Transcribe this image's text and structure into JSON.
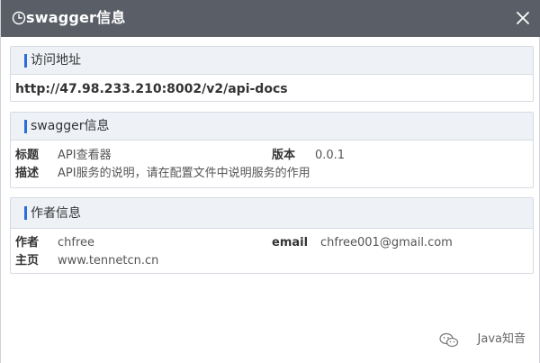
{
  "titlebar": {
    "title": "swagger信息",
    "clock_icon": "clock-icon",
    "close_icon": "close-icon"
  },
  "access_section": {
    "header": "访问地址",
    "url": "http://47.98.233.210:8002/v2/api-docs"
  },
  "swagger_section": {
    "header": "swagger信息",
    "title_key": "标题",
    "title_value": "API查看器",
    "version_key": "版本",
    "version_value": "0.0.1",
    "desc_key": "描述",
    "desc_value": "API服务的说明，请在配置文件中说明服务的作用"
  },
  "author_section": {
    "header": "作者信息",
    "author_key": "作者",
    "author_value": "chfree",
    "email_key": "email",
    "email_value": "chfree001@gmail.com",
    "homepage_key": "主页",
    "homepage_value": "www.tennetcn.cn"
  },
  "watermark": {
    "text": "Java知音",
    "icon": "wechat-icon"
  },
  "colors": {
    "titlebar": "#5a5e66",
    "accent_bar": "#2a6fd6",
    "panel_header_bg": "#eef2f7",
    "panel_border": "#d5dae3"
  }
}
